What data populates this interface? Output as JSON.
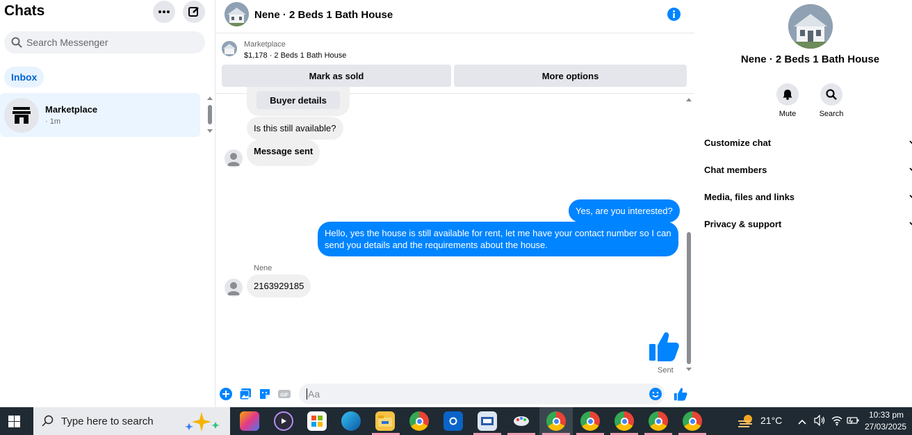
{
  "sidebar": {
    "title": "Chats",
    "search_placeholder": "Search Messenger",
    "inbox_label": "Inbox",
    "conversation": {
      "name": "Marketplace",
      "time": "· 1m"
    }
  },
  "header": {
    "title": "Nene · 2 Beds 1 Bath House"
  },
  "marketplace": {
    "label": "Marketplace",
    "listing": "$1,178 · 2 Beds 1 Bath House",
    "mark_sold": "Mark as sold",
    "more_options": "More options"
  },
  "messages": {
    "buyer_details": "Buyer details",
    "still_available": "Is this still available?",
    "message_sent": "Message sent",
    "out1": "Yes, are you interested?",
    "out2": "Hello, yes the house is still available for rent, let me have your contact number so I can send you details and the requirements about the house.",
    "sender_name": "Nene",
    "phone": "2163929185",
    "sent_status": "Sent"
  },
  "composer": {
    "placeholder": "Aa"
  },
  "right_panel": {
    "title": "Nene · 2 Beds 1 Bath House",
    "mute": "Mute",
    "search": "Search",
    "sections": [
      "Customize chat",
      "Chat members",
      "Media, files and links",
      "Privacy & support"
    ]
  },
  "taskbar": {
    "search_placeholder": "Type here to search",
    "weather": "21°C",
    "time": "10:33 pm",
    "date": "27/03/2025"
  },
  "colors": {
    "accent": "#0084ff",
    "sidebar_active": "#ebf5ff"
  }
}
